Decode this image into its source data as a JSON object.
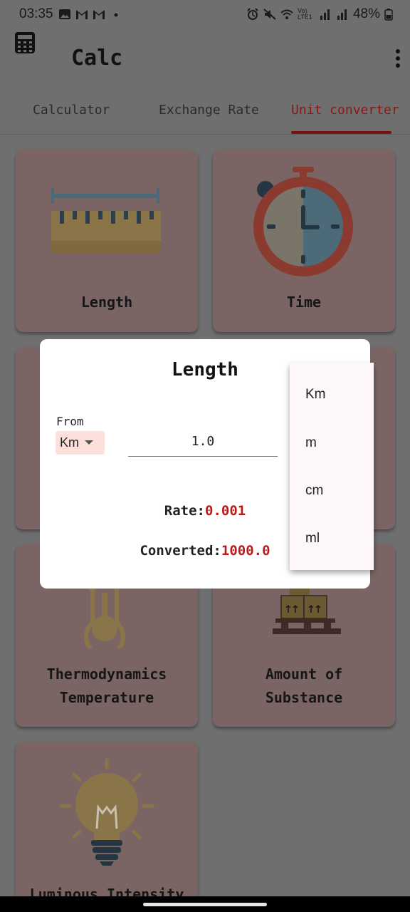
{
  "status_bar": {
    "time": "03:35",
    "battery": "48%",
    "network": "Vo) LTE1"
  },
  "app": {
    "title": "Calc"
  },
  "tabs": [
    {
      "label": "Calculator",
      "active": false
    },
    {
      "label": "Exchange Rate",
      "active": false
    },
    {
      "label": "Unit converter",
      "active": true
    }
  ],
  "cards": [
    {
      "label_lines": [
        "Length"
      ],
      "icon": "ruler-icon"
    },
    {
      "label_lines": [
        "Time"
      ],
      "icon": "stopwatch-icon"
    },
    {
      "label_lines": [
        "Thermodynamics",
        "Temperature"
      ],
      "icon": "thermometer-icon"
    },
    {
      "label_lines": [
        "Amount of",
        "Substance"
      ],
      "icon": "boxes-pallet-icon"
    },
    {
      "label_lines": [
        "Luminous Intensity"
      ],
      "icon": "light-bulb-icon"
    }
  ],
  "dialog": {
    "title": "Length",
    "from_label": "From",
    "selected_unit": "Km",
    "amount": "1.0",
    "rate_label": "Rate:",
    "rate_value": "0.001",
    "converted_label": "Converted:",
    "converted_value": "1000.0"
  },
  "unit_options": [
    "Km",
    "m",
    "cm",
    "ml"
  ],
  "colors": {
    "accent": "#8a1818",
    "result": "#b71c1c",
    "card": "#7a6564",
    "scrim": "#6f6f6f",
    "chip": "#fde0dc"
  }
}
